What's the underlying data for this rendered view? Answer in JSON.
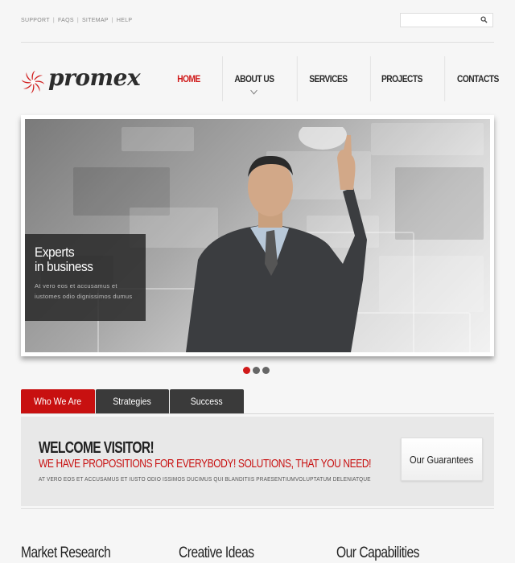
{
  "util_links": [
    "SUPPORT",
    "FAQS",
    "SITEMAP",
    "HELP"
  ],
  "search": {
    "placeholder": ""
  },
  "brand": {
    "name": "promex",
    "accent": "#d01919"
  },
  "nav": {
    "items": [
      {
        "label": "HOME",
        "active": true
      },
      {
        "label": "ABOUT US"
      },
      {
        "label": "SERVICES"
      },
      {
        "label": "PROJECTS"
      },
      {
        "label": "CONTACTS"
      }
    ]
  },
  "slider": {
    "caption_title": "Experts\nin business",
    "caption_text": "At vero eos et accusamus et iustomes odio dignissimos dumus",
    "dots": 3,
    "active_dot": 0
  },
  "tabs": [
    {
      "label": "Who We Are",
      "active": true
    },
    {
      "label": "Strategies"
    },
    {
      "label": "Success"
    }
  ],
  "welcome": {
    "heading": "WELCOME VISITOR!",
    "subheading": "WE HAVE PROPOSITIONS FOR EVERYBODY! SOLUTIONS, THAT YOU NEED!",
    "text": "AT VERO EOS ET ACCUSAMUS ET IUSTO ODIO ISSIMOS DUCIMUS QUI BLANDITIIS PRAESENTIUMVOLUPTATUM DELENIATQUE",
    "button": "Our Guarantees"
  },
  "columns": [
    "Market Research",
    "Creative Ideas",
    "Our Capabilities"
  ]
}
